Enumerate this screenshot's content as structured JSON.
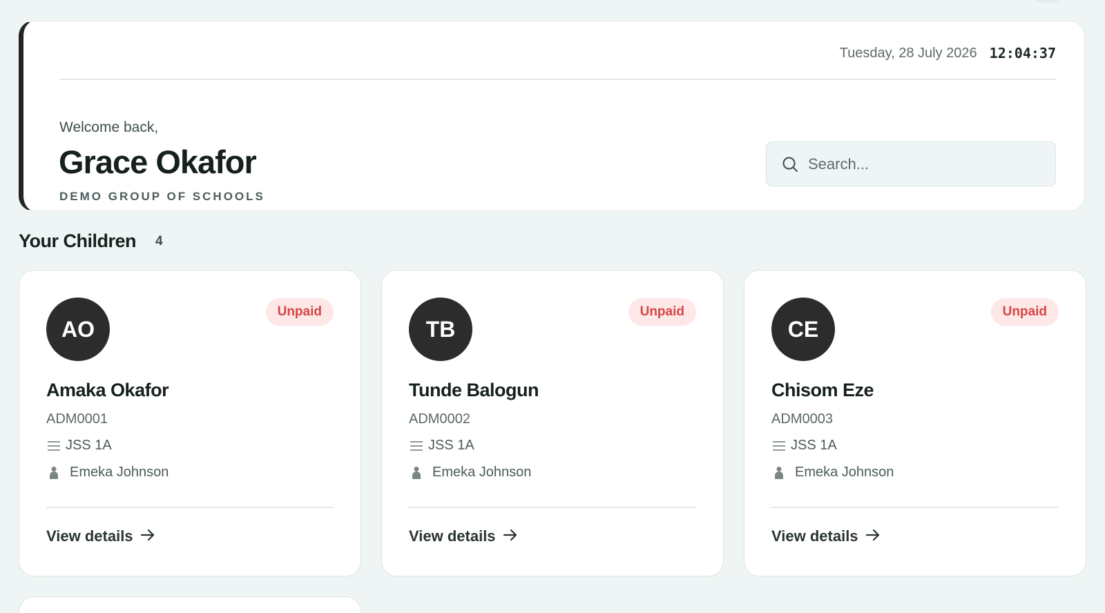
{
  "header": {
    "date": "Tuesday, 28 July 2026",
    "time": "12:04:37",
    "welcome": "Welcome back,",
    "user_name": "Grace Okafor",
    "org_name": "DEMO GROUP OF SCHOOLS",
    "search_placeholder": "Search..."
  },
  "children_section": {
    "title": "Your Children",
    "count": "4"
  },
  "children": [
    {
      "initials": "AO",
      "status": "Unpaid",
      "name": "Amaka Okafor",
      "admission_no": "ADM0001",
      "class": "JSS 1A",
      "teacher": "Emeka Johnson",
      "action": "View details"
    },
    {
      "initials": "TB",
      "status": "Unpaid",
      "name": "Tunde Balogun",
      "admission_no": "ADM0002",
      "class": "JSS 1A",
      "teacher": "Emeka Johnson",
      "action": "View details"
    },
    {
      "initials": "CE",
      "status": "Unpaid",
      "name": "Chisom Eze",
      "admission_no": "ADM0003",
      "class": "JSS 1A",
      "teacher": "Emeka Johnson",
      "action": "View details"
    }
  ],
  "colors": {
    "background": "#eff5f4",
    "accent_dark": "#232525",
    "unpaid_text": "#d64545",
    "unpaid_bg": "#fde7e7"
  },
  "icons": {
    "search": "search-icon",
    "class": "list-icon",
    "teacher": "user-icon",
    "arrow": "arrow-right-icon"
  }
}
